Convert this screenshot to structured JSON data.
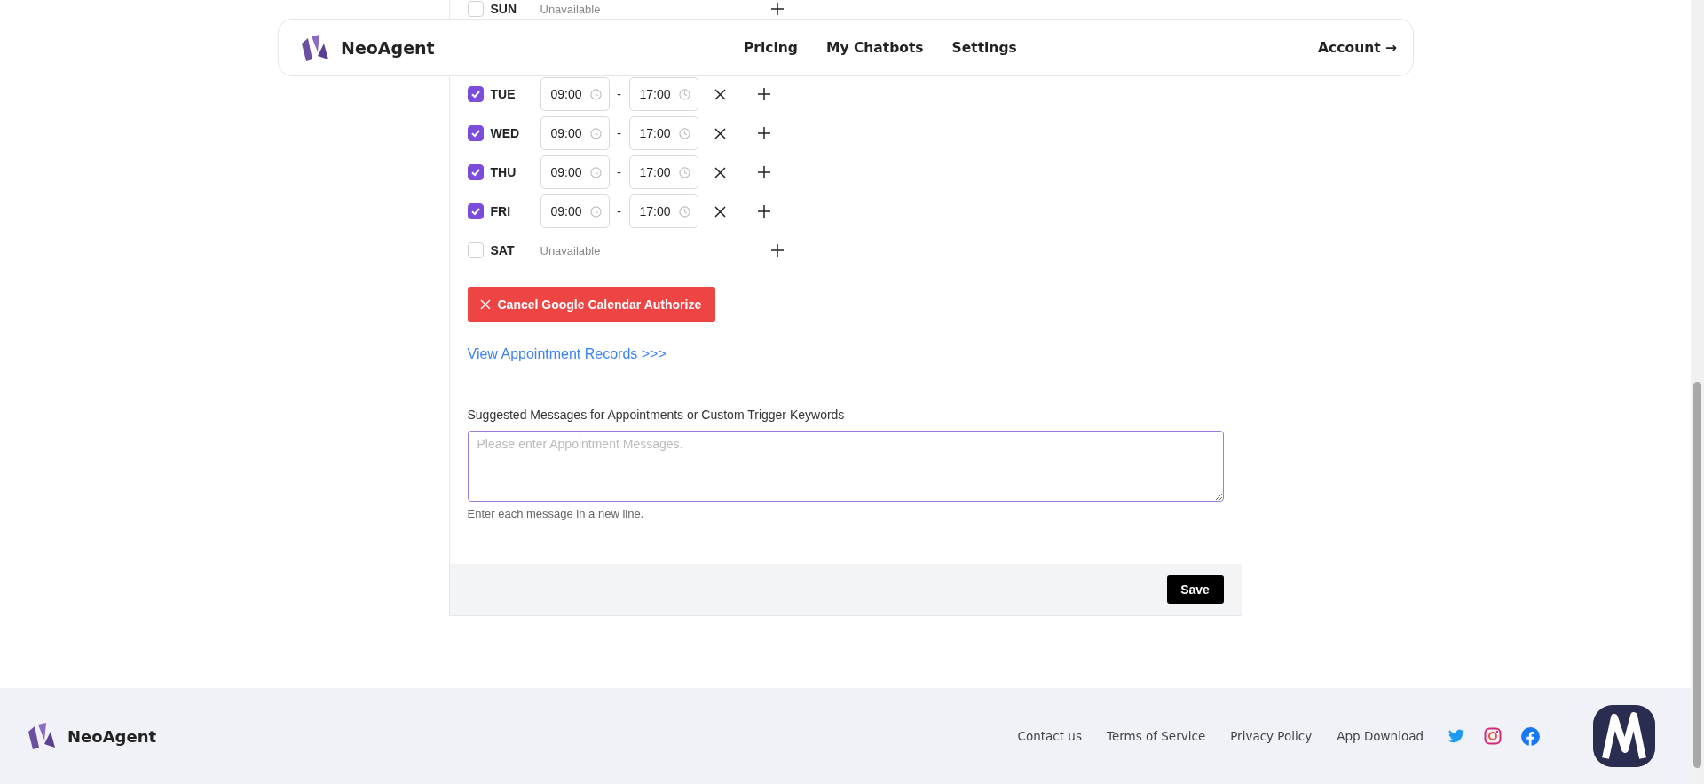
{
  "header": {
    "brand": "NeoAgent",
    "nav": [
      {
        "label": "Pricing"
      },
      {
        "label": "My Chatbots"
      },
      {
        "label": "Settings"
      }
    ],
    "account": "Account →"
  },
  "schedule": [
    {
      "day": "SUN",
      "kind": "unavailable",
      "checked": false,
      "note": "Unavailable"
    },
    {
      "kind": "hidden"
    },
    {
      "day": "TUE",
      "kind": "available",
      "checked": true,
      "start": "09:00",
      "end": "17:00",
      "separator": "-"
    },
    {
      "day": "WED",
      "kind": "available",
      "checked": true,
      "start": "09:00",
      "end": "17:00",
      "separator": "-"
    },
    {
      "day": "THU",
      "kind": "available",
      "checked": true,
      "start": "09:00",
      "end": "17:00",
      "separator": "-"
    },
    {
      "day": "FRI",
      "kind": "available",
      "checked": true,
      "start": "09:00",
      "end": "17:00",
      "separator": "-"
    },
    {
      "day": "SAT",
      "kind": "unavailable",
      "checked": false,
      "note": "Unavailable"
    }
  ],
  "cancel_button": "Cancel Google Calendar Authorize",
  "records_link": "View Appointment Records >>>",
  "messages": {
    "label": "Suggested Messages for Appointments or Custom Trigger Keywords",
    "placeholder": "Please enter Appointment Messages.",
    "hint": "Enter each message in a new line."
  },
  "save_button": "Save",
  "footer": {
    "brand": "NeoAgent",
    "links": [
      "Contact us",
      "Terms of Service",
      "Privacy Policy",
      "App Download"
    ]
  }
}
